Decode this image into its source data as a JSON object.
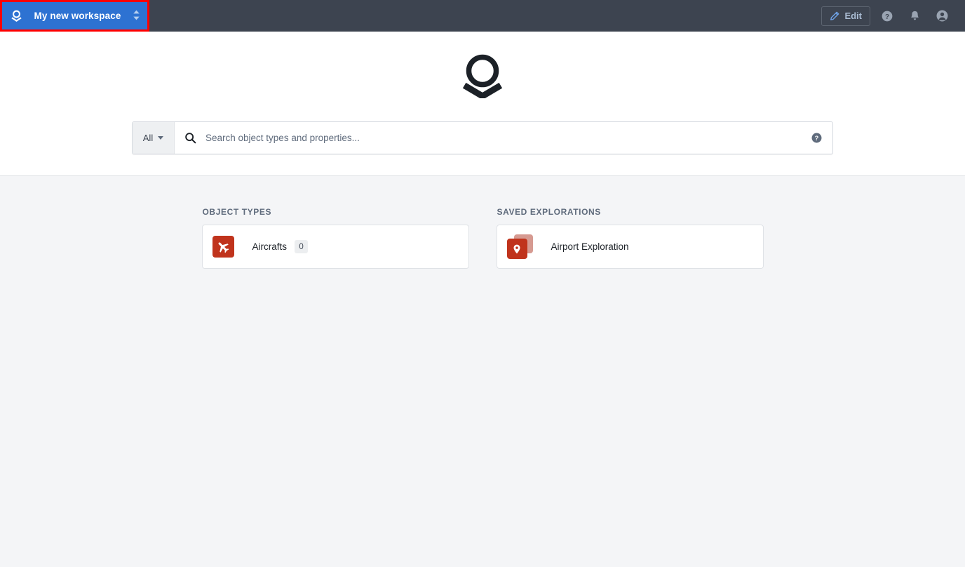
{
  "topbar": {
    "workspace": {
      "name": "My new workspace",
      "logo_icon": "foundry-logo-icon",
      "selector_icon": "double-caret-vertical-icon",
      "highlighted": true,
      "highlight_color": "#ff0000",
      "background_color": "#2d72d2"
    },
    "edit_button": {
      "label": "Edit",
      "icon": "pencil-icon"
    },
    "help_icon": "help-circle-icon",
    "notifications_icon": "bell-icon",
    "user_icon": "user-avatar-icon",
    "background_color": "#3d4450"
  },
  "hero": {
    "logo_icon": "foundry-logo-icon",
    "search": {
      "scope_label": "All",
      "scope_caret_icon": "caret-down-icon",
      "search_icon": "search-icon",
      "placeholder": "Search object types and properties...",
      "value": "",
      "help_icon": "help-circle-icon"
    }
  },
  "main": {
    "object_types": {
      "title": "OBJECT TYPES",
      "items": [
        {
          "label": "Aircrafts",
          "count": "0",
          "icon": "airplane-icon",
          "icon_color": "#c0331c"
        }
      ]
    },
    "saved_explorations": {
      "title": "SAVED EXPLORATIONS",
      "items": [
        {
          "label": "Airport Exploration",
          "icon": "map-pin-stacked-icon",
          "icon_color": "#c0331c",
          "icon_back_color": "#d69a91"
        }
      ]
    }
  }
}
